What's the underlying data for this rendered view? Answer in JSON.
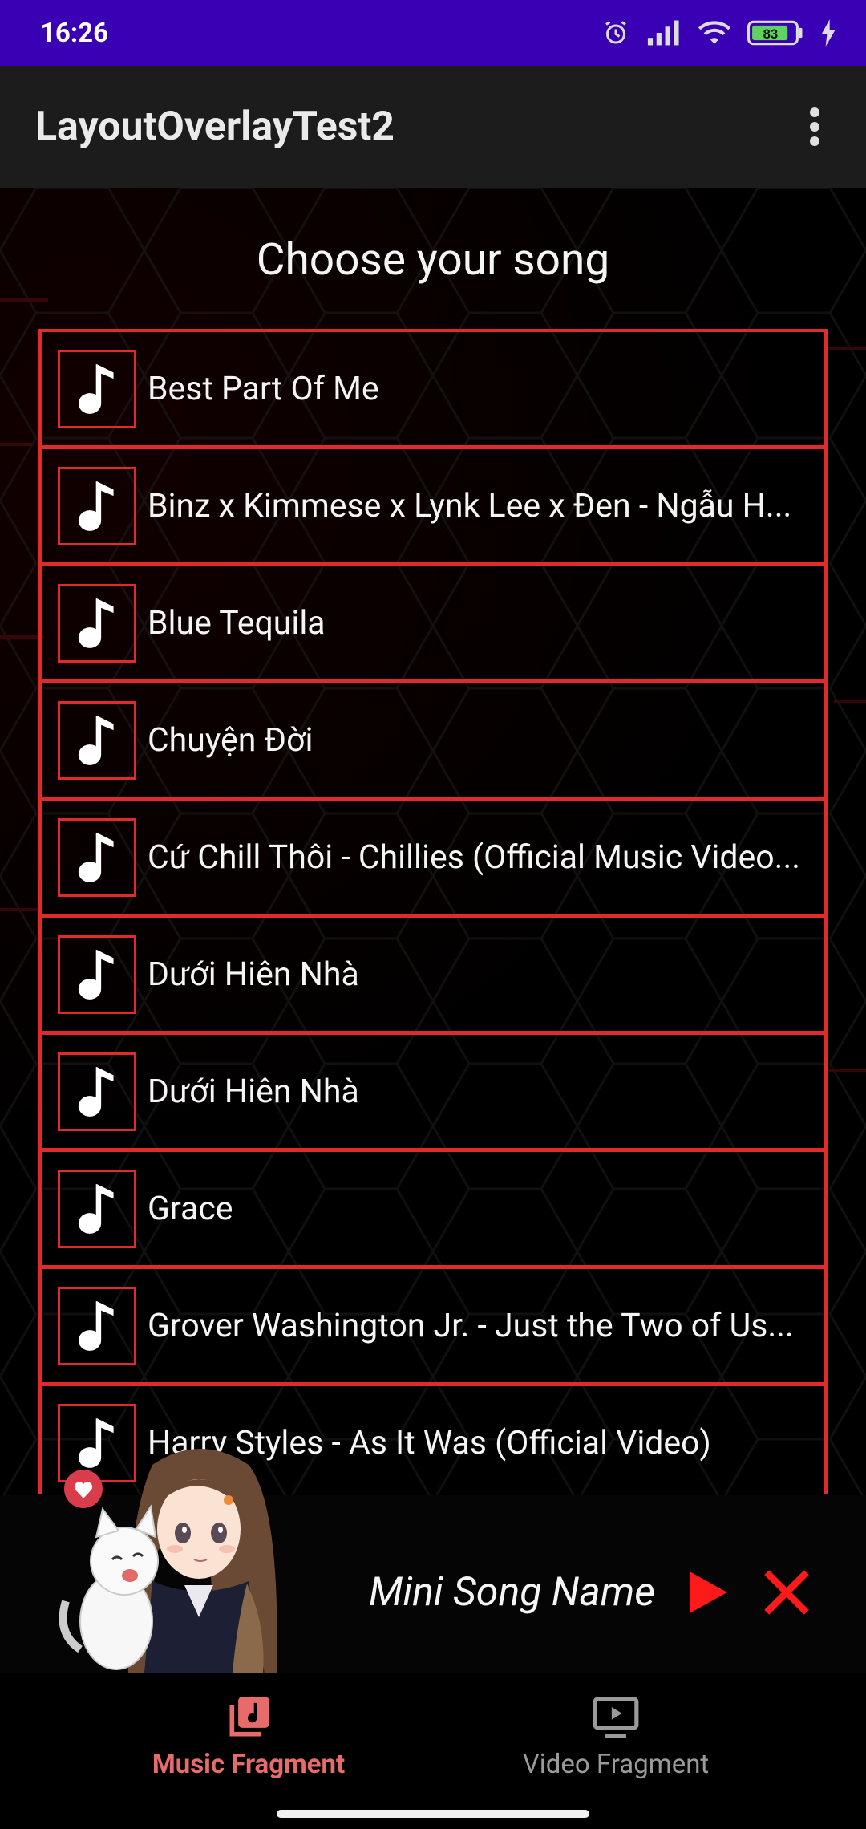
{
  "status_bar": {
    "time": "16:26",
    "battery": "83",
    "icons": [
      "alarm-icon",
      "signal-icon",
      "wifi-icon",
      "battery-icon",
      "charging-icon"
    ]
  },
  "app_bar": {
    "title": "LayoutOverlayTest2",
    "menu_icon": "more-vert-icon"
  },
  "main": {
    "heading": "Choose your song",
    "songs": [
      {
        "title": "Best Part Of Me"
      },
      {
        "title": "Binz x Kimmese x Lynk Lee x Đen - Ngẫu H..."
      },
      {
        "title": "Blue Tequila"
      },
      {
        "title": "Chuyện Đời"
      },
      {
        "title": "Cứ Chill Thôi - Chillies (Official Music Video..."
      },
      {
        "title": "Dưới Hiên Nhà"
      },
      {
        "title": "Dưới Hiên Nhà"
      },
      {
        "title": "Grace"
      },
      {
        "title": "Grover Washington Jr. - Just the Two of Us..."
      },
      {
        "title": "Harry Styles - As It Was (Official Video)"
      }
    ],
    "song_icon": "music-note-icon"
  },
  "mini_player": {
    "song_name": "Mini Song Name",
    "play_icon": "play-icon",
    "close_icon": "close-icon"
  },
  "bottom_nav": {
    "items": [
      {
        "label": "Music Fragment",
        "icon": "music-library-icon",
        "active": true
      },
      {
        "label": "Video Fragment",
        "icon": "video-player-icon",
        "active": false
      }
    ]
  },
  "colors": {
    "status_bar": "#3a00b3",
    "accent_red": "#e12b2b",
    "nav_active": "#e86b6b",
    "nav_inactive": "#9a9a9a"
  }
}
